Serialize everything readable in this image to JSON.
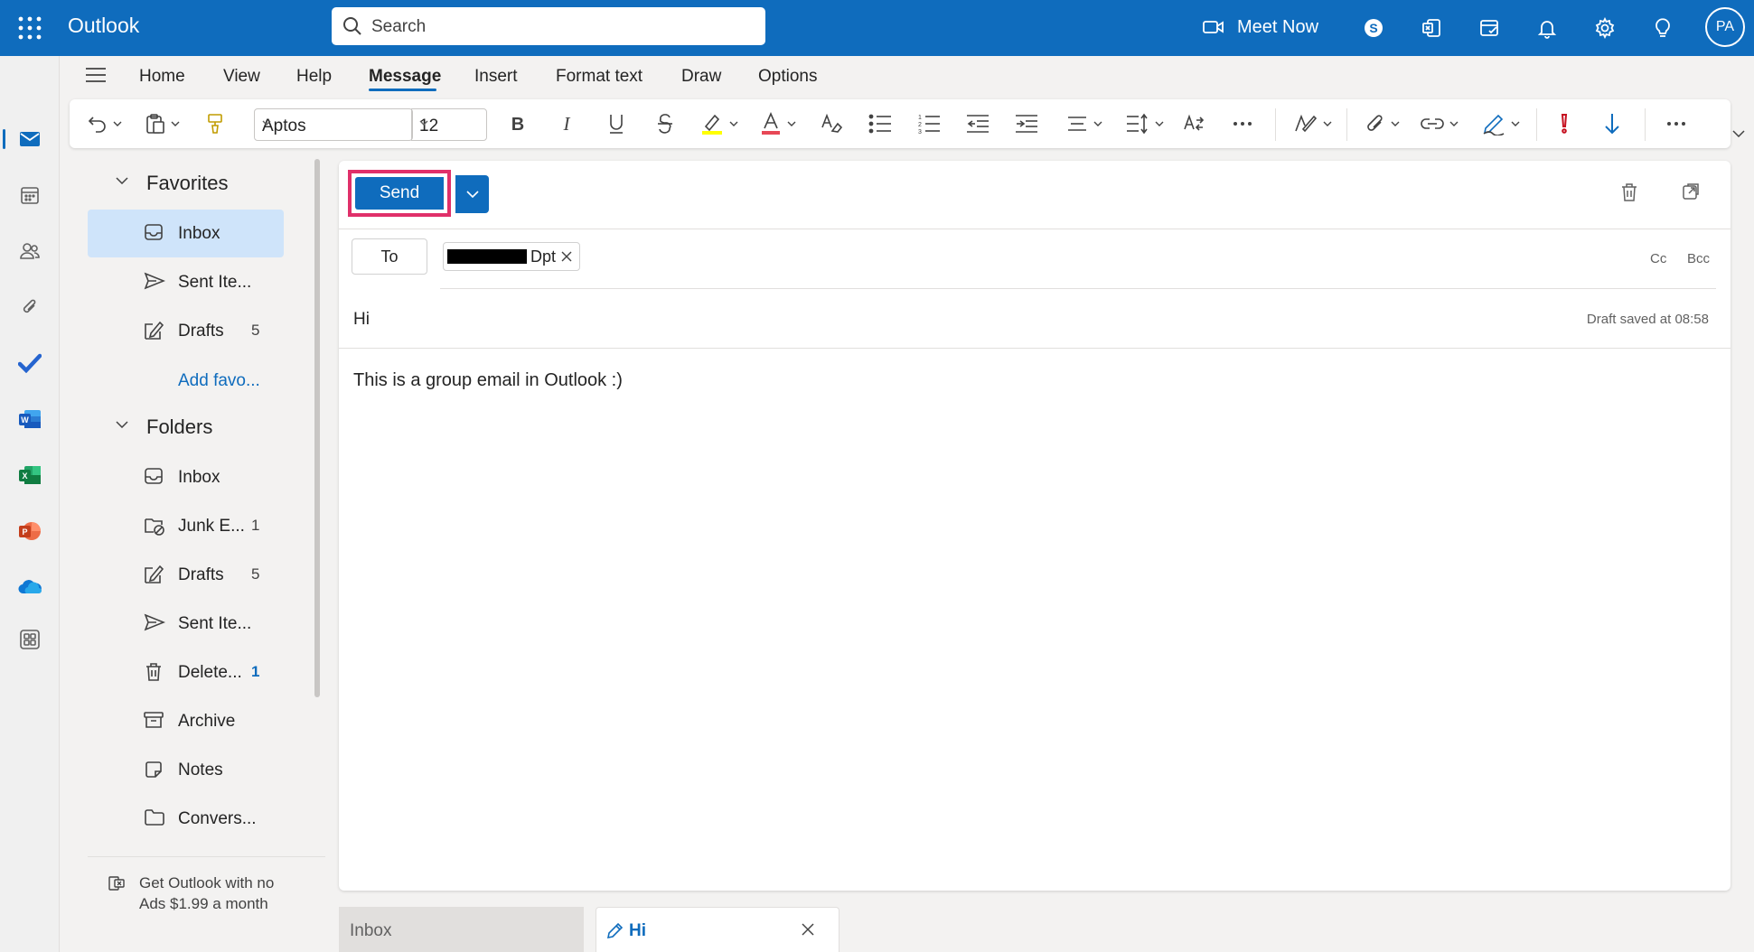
{
  "app": {
    "title": "Outlook"
  },
  "search": {
    "placeholder": "Search"
  },
  "header": {
    "meet_now_label": "Meet Now",
    "avatar_initials": "PA"
  },
  "ribbon": {
    "tabs": [
      "Home",
      "View",
      "Help",
      "Message",
      "Insert",
      "Format text",
      "Draw",
      "Options"
    ],
    "active_tab": "Message",
    "font_name": "Aptos",
    "font_size": "12"
  },
  "folders": {
    "favorites_heading": "Favorites",
    "favorites": [
      {
        "label": "Inbox",
        "count": "",
        "icon": "inbox-icon",
        "selected": true
      },
      {
        "label": "Sent Ite...",
        "count": "",
        "icon": "send-icon"
      },
      {
        "label": "Drafts",
        "count": "5",
        "icon": "drafts-icon"
      }
    ],
    "add_favorite_label": "Add favo...",
    "folders_heading": "Folders",
    "folders": [
      {
        "label": "Inbox",
        "count": "",
        "icon": "inbox-icon"
      },
      {
        "label": "Junk E...",
        "count": "1",
        "icon": "junk-icon"
      },
      {
        "label": "Drafts",
        "count": "5",
        "icon": "drafts-icon"
      },
      {
        "label": "Sent Ite...",
        "count": "",
        "icon": "send-icon"
      },
      {
        "label": "Delete...",
        "count": "1",
        "icon": "trash-icon"
      },
      {
        "label": "Archive",
        "count": "",
        "icon": "archive-icon"
      },
      {
        "label": "Notes",
        "count": "",
        "icon": "notes-icon"
      },
      {
        "label": "Convers...",
        "count": "",
        "icon": "folder-icon"
      }
    ],
    "promo_text": "Get Outlook with no Ads $1.99 a month"
  },
  "compose": {
    "send_label": "Send",
    "to_label": "To",
    "recipient_label": "Dpt",
    "cc_label": "Cc",
    "bcc_label": "Bcc",
    "subject": "Hi",
    "draft_status": "Draft saved at 08:58",
    "body": "This is a group email in Outlook :)"
  },
  "bottom_tabs": {
    "inbox_label": "Inbox",
    "draft_label": "Hi"
  },
  "colors": {
    "brand": "#0f6cbd",
    "highlight_border": "#e0306a",
    "selected_folder": "#cfe4fa"
  }
}
